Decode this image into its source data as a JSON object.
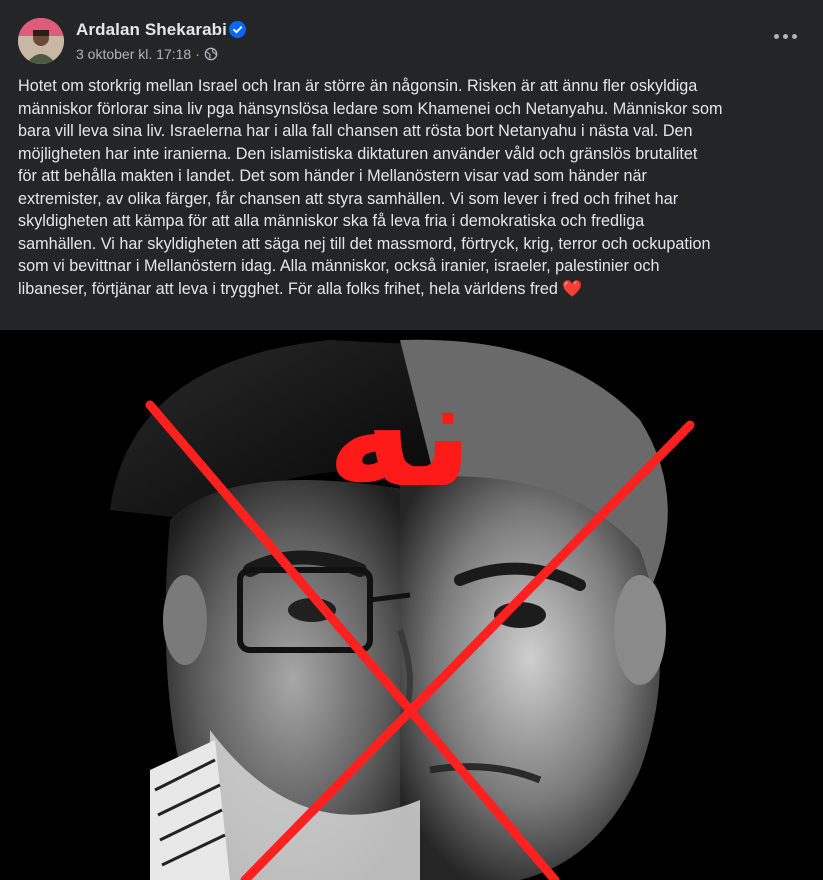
{
  "post": {
    "author": "Ardalan Shekarabi",
    "verified": true,
    "timestamp": "3 oktober kl. 17:18",
    "audience_icon": "globe-icon",
    "separator": "·",
    "menu_icon": "more-options-icon",
    "text": "Hotet om storkrig mellan Israel och Iran är större än någonsin. Risken är att ännu fler oskyldiga\nmänniskor förlorar sina liv pga hänsynslösa ledare som Khamenei och Netanyahu. Människor som\nbara vill leva sina liv. Israelerna har i alla fall chansen att rösta bort Netanyahu i nästa val. Den\nmöjligheten har inte iranierna. Den islamistiska diktaturen använder våld och gränslös brutalitet\nför att behålla makten i landet. Det som händer i Mellanöstern visar vad som händer när\nextremister, av olika färger, får chansen att styra samhällen. Vi som lever i fred och frihet har\nskyldigheten att kämpa för att alla människor ska få leva fria i demokratiska och fredliga\nsamhällen. Vi har skyldigheten att säga nej till det massmord, förtryck, krig, terror och ockupation\nsom vi bevittnar i Mellanöstern idag. Alla människor, också iranier, israeler, palestinier och\nlibaneser, förtjänar att leva i trygghet. För alla folks frihet, hela världens fred ",
    "emoji": "❤️"
  },
  "image": {
    "overlay_text": "نه",
    "overlay_color": "#ff1a1a",
    "cross_color": "#ff2020"
  },
  "colors": {
    "card_bg": "#242526",
    "text_primary": "#e4e6eb",
    "text_secondary": "#b0b3b8",
    "verified_blue": "#0866ff"
  }
}
